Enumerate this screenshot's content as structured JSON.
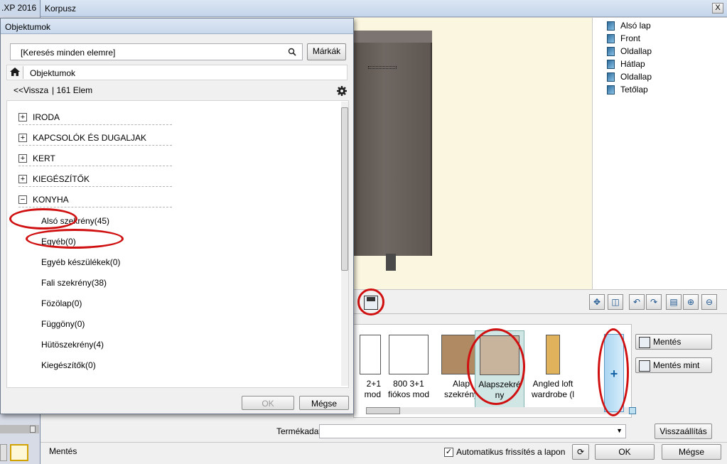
{
  "background_app": {
    "title": ".XP 2016 -"
  },
  "korpusz": {
    "title": "Korpusz",
    "close_label": "X",
    "parts": [
      "Alsó lap",
      "Front",
      "Oldallap",
      "Hátlap",
      "Oldallap",
      "Tetőlap"
    ],
    "thumbnails": [
      {
        "label": "2+1\nmod"
      },
      {
        "label": "800 3+1\nfiókos mod"
      },
      {
        "label": "Alap\nszekrény"
      },
      {
        "label": "Alapszekré\nny",
        "selected": true
      },
      {
        "label": "Angled loft\nwardrobe (l"
      }
    ],
    "add_button": "+",
    "save_button": "Mentés",
    "save_as_button": "Mentés mint",
    "product_data_label": "Termékadat",
    "product_data_value": "",
    "reset_button": "Visszaállítás",
    "status_label": "Mentés",
    "auto_refresh_label": "Automatikus frissítés a lapon",
    "auto_refresh_checked": true,
    "checkbox_mark": "✓",
    "ok_button": "OK",
    "cancel_button": "Mégse",
    "highlight_color": "#d01010"
  },
  "objektumok": {
    "title": "Objektumok",
    "search_placeholder": "[Keresés minden elemre]",
    "brands_button": "Márkák",
    "breadcrumb": "Objektumok",
    "back_link": "<<Vissza",
    "count_label": "| 161 Elem",
    "categories": [
      {
        "label": "IRODA",
        "state": "+"
      },
      {
        "label": "KAPCSOLÓK ÉS DUGALJAK",
        "state": "+"
      },
      {
        "label": "KERT",
        "state": "+"
      },
      {
        "label": "KIEGÉSZÍTŐK",
        "state": "+"
      },
      {
        "label": "KONYHA",
        "state": "−"
      }
    ],
    "subitems": [
      "Alsó szekrény(45)",
      "Egyéb(0)",
      "Egyéb készülékek(0)",
      "Fali szekrény(38)",
      "Fözölap(0)",
      "Függöny(0)",
      "Hütöszekrény(4)",
      "Kiegészítők(0)"
    ],
    "ok_button": "OK",
    "cancel_button": "Mégse"
  }
}
